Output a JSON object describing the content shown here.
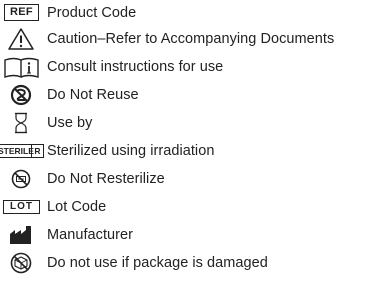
{
  "symbols": [
    {
      "icon": "ref-box-icon",
      "icon_text": "REF",
      "label": "Product Code"
    },
    {
      "icon": "caution-triangle-icon",
      "label": "Caution–Refer to Accompanying Documents"
    },
    {
      "icon": "consult-instructions-book-icon",
      "label": "Consult instructions for use"
    },
    {
      "icon": "do-not-reuse-icon",
      "label": "Do Not Reuse"
    },
    {
      "icon": "hourglass-icon",
      "label": "Use by"
    },
    {
      "icon": "sterile-r-box-icon",
      "icon_text": "STERILE",
      "icon_text_2": "R",
      "label": "Sterilized using irradiation"
    },
    {
      "icon": "do-not-resterilize-icon",
      "label": "Do Not Resterilize"
    },
    {
      "icon": "lot-box-icon",
      "icon_text": "LOT",
      "label": "Lot Code"
    },
    {
      "icon": "manufacturer-factory-icon",
      "label": "Manufacturer"
    },
    {
      "icon": "do-not-use-if-damaged-icon",
      "label": "Do not use if package is damaged"
    }
  ]
}
